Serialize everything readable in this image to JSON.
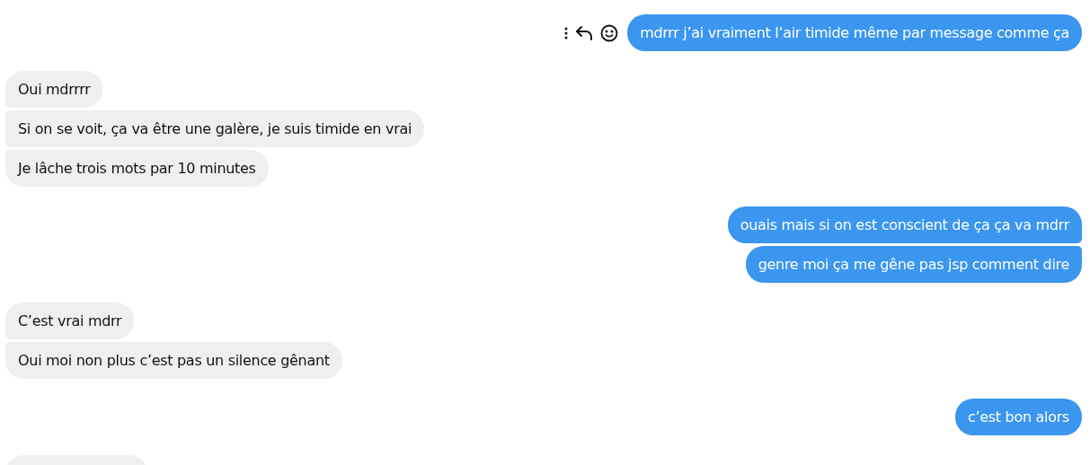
{
  "conversation": [
    {
      "kind": "sent",
      "messages": [
        {
          "text": "mdrrr j’ai vraiment l‘air timide même par message comme ça",
          "hovered": true
        }
      ]
    },
    {
      "kind": "received",
      "messages": [
        {
          "text": "Oui mdrrrr",
          "hovered": false
        },
        {
          "text": "Si on se voit, ça va être une galère, je suis timide en vrai",
          "hovered": false
        },
        {
          "text": "Je lâche trois mots  par 10 minutes",
          "hovered": false
        }
      ]
    },
    {
      "kind": "sent",
      "messages": [
        {
          "text": "ouais mais si on est conscient de ça ça va mdrr",
          "hovered": false
        },
        {
          "text": "genre moi ça me gêne pas jsp comment dire",
          "hovered": false
        }
      ]
    },
    {
      "kind": "received",
      "messages": [
        {
          "text": "C’est vrai mdrr",
          "hovered": false
        },
        {
          "text": "Oui moi non plus c’est pas un silence gênant",
          "hovered": false
        }
      ]
    },
    {
      "kind": "sent",
      "messages": [
        {
          "text": "c’est bon alors",
          "hovered": false
        }
      ]
    },
    {
      "kind": "received",
      "messages": [
        {
          "kind": "cut",
          "hovered": false
        }
      ]
    }
  ]
}
